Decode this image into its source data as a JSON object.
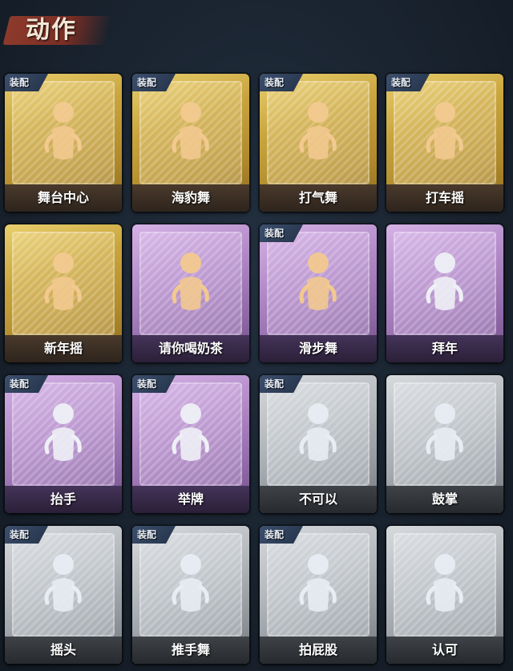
{
  "page": {
    "title": "动作"
  },
  "colors": {
    "background": "#1a2330",
    "gold": "#c9a53e",
    "purple": "#b088c6",
    "grey": "#b3b8bd",
    "title_banner": "#8d3a2c"
  },
  "equip_label": "装配",
  "cards": [
    {
      "label": "舞台中心",
      "rarity": "gold",
      "equipped": true,
      "icon": "dancer-center-icon"
    },
    {
      "label": "海豹舞",
      "rarity": "gold",
      "equipped": true,
      "icon": "seal-dance-icon"
    },
    {
      "label": "打气舞",
      "rarity": "gold",
      "equipped": true,
      "icon": "cheer-dance-icon"
    },
    {
      "label": "打车摇",
      "rarity": "gold",
      "equipped": true,
      "icon": "car-sway-icon"
    },
    {
      "label": "新年摇",
      "rarity": "gold",
      "equipped": false,
      "icon": "new-year-sway-icon"
    },
    {
      "label": "请你喝奶茶",
      "rarity": "purple",
      "equipped": false,
      "icon": "milk-tea-sign-icon"
    },
    {
      "label": "滑步舞",
      "rarity": "purple",
      "equipped": true,
      "icon": "slide-dance-icon"
    },
    {
      "label": "拜年",
      "rarity": "purple",
      "equipped": false,
      "icon": "greeting-bow-icon"
    },
    {
      "label": "抬手",
      "rarity": "purple",
      "equipped": true,
      "icon": "raise-hand-icon"
    },
    {
      "label": "举牌",
      "rarity": "purple",
      "equipped": true,
      "icon": "hold-sign-icon"
    },
    {
      "label": "不可以",
      "rarity": "grey",
      "equipped": true,
      "icon": "finger-wag-icon"
    },
    {
      "label": "鼓掌",
      "rarity": "grey",
      "equipped": false,
      "icon": "clapping-hands-icon"
    },
    {
      "label": "摇头",
      "rarity": "grey",
      "equipped": true,
      "icon": "shake-head-icon"
    },
    {
      "label": "推手舞",
      "rarity": "grey",
      "equipped": true,
      "icon": "push-hand-dance-icon"
    },
    {
      "label": "拍屁股",
      "rarity": "grey",
      "equipped": true,
      "icon": "slap-butt-icon"
    },
    {
      "label": "认可",
      "rarity": "grey",
      "equipped": false,
      "icon": "thumbs-up-icon"
    }
  ]
}
